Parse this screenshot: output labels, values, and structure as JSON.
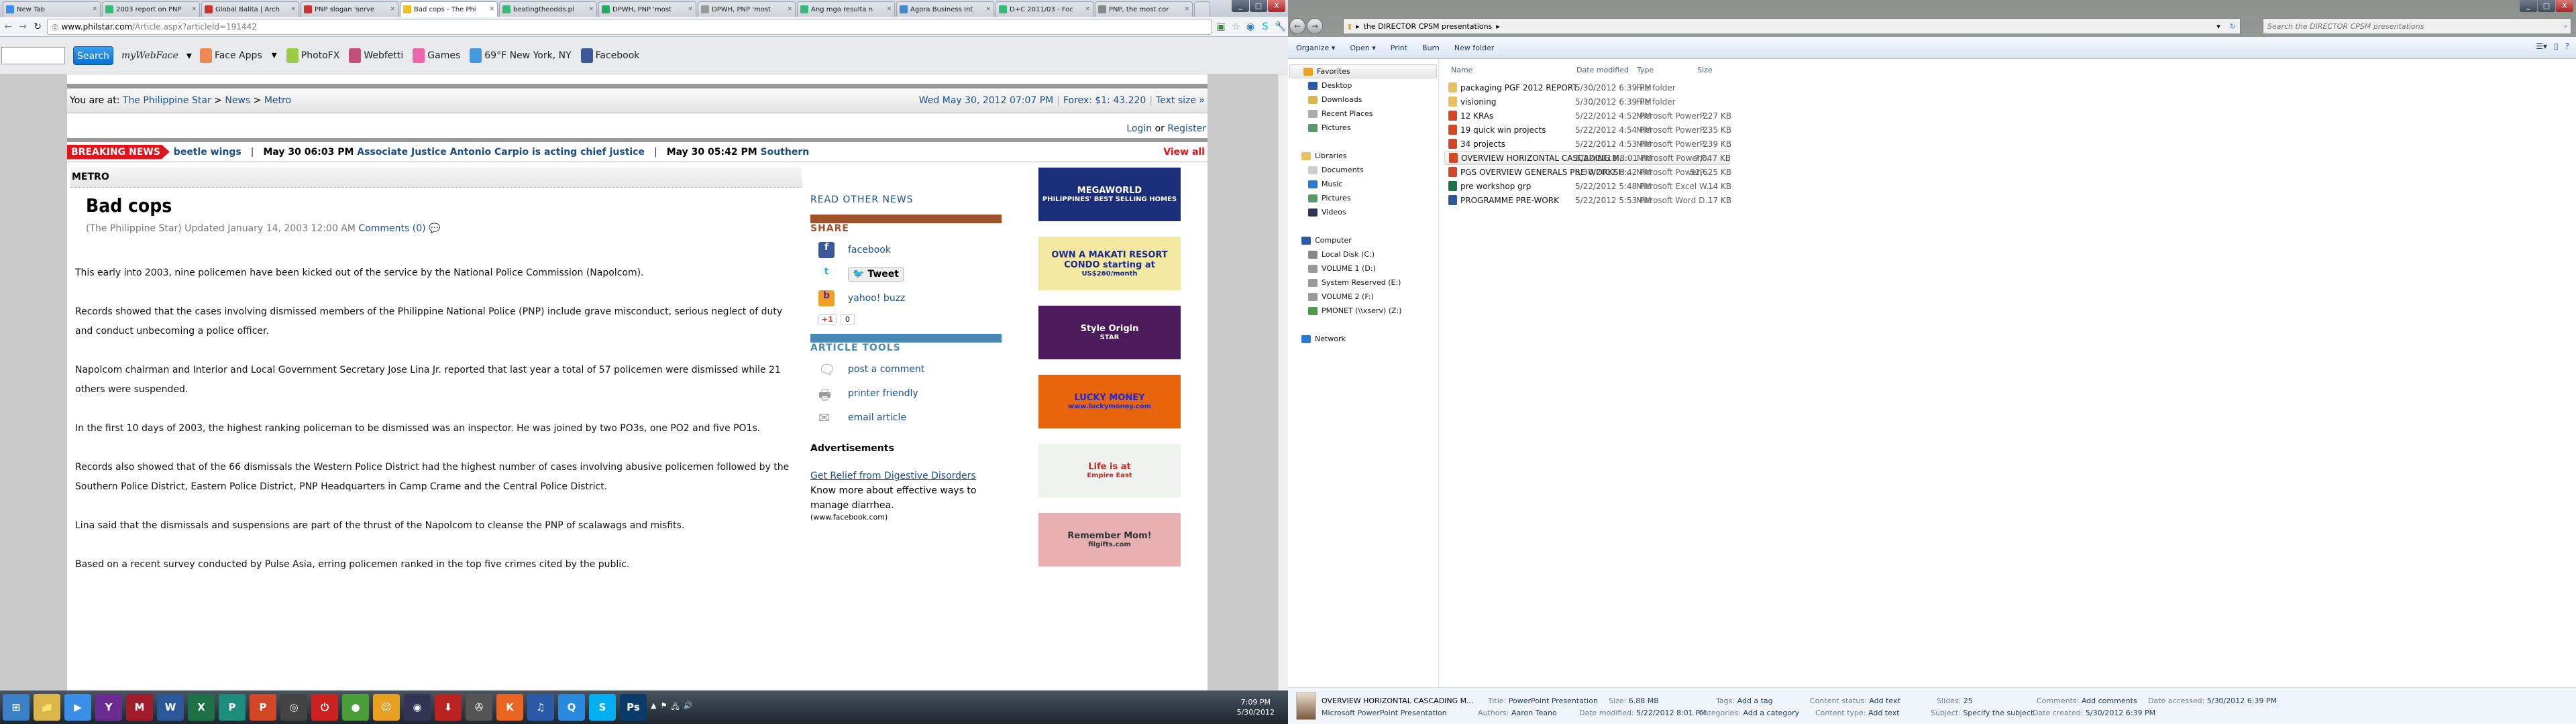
{
  "browser": {
    "tabs": [
      {
        "title": "New Tab",
        "color": "#3a8ee6"
      },
      {
        "title": "2003 report on PNP",
        "color": "#3b7"
      },
      {
        "title": "Global Balita | Arch",
        "color": "#c33"
      },
      {
        "title": "PNP slogan 'serve",
        "color": "#c33"
      },
      {
        "title": "Bad cops - The Phi",
        "color": "#f0c020",
        "active": true
      },
      {
        "title": "beatingtheodds.pl",
        "color": "#3b7"
      },
      {
        "title": "DPWH, PNP 'most",
        "color": "#2a6"
      },
      {
        "title": "DPWH, PNP 'most",
        "color": "#999"
      },
      {
        "title": "Ang mga resulta n",
        "color": "#3b7"
      },
      {
        "title": "Agora Business Int",
        "color": "#48c"
      },
      {
        "title": "D+C 2011/03 - Foc",
        "color": "#3b7"
      },
      {
        "title": "PNP, the most cor",
        "color": "#888"
      }
    ],
    "window_buttons": [
      "_",
      "□",
      "X"
    ],
    "url_host": "www.philstar.com",
    "url_path": "/Article.aspx?articleId=191442",
    "toolbar": {
      "search_placeholder": "",
      "search_label": "Search",
      "mywebface": "myWebFace",
      "items": [
        {
          "label": "Face Apps",
          "color": "#e85"
        },
        {
          "label": "PhotoFX",
          "color": "#9c4"
        },
        {
          "label": "Webfetti",
          "color": "#c2507a"
        },
        {
          "label": "Games",
          "color": "#e6a"
        },
        {
          "label": "69°F New York, NY",
          "color": "#49d"
        },
        {
          "label": "Facebook",
          "color": "#3b5998"
        }
      ]
    }
  },
  "site": {
    "breadcrumb_prefix": "You are at:",
    "breadcrumb": [
      "The Philippine Star",
      "News",
      "Metro"
    ],
    "date": "Wed May 30, 2012 07:07 PM",
    "forex": "Forex: $1: 43.220",
    "text_size": "Text size  »",
    "login": "Login",
    "or": "or",
    "register": "Register",
    "breaking_label": "BREAKING NEWS",
    "ticker": [
      {
        "time": "",
        "head": "beetle wings"
      },
      {
        "time": "May 30 06:03 PM",
        "head": "Associate Justice Antonio Carpio is acting chief justice"
      },
      {
        "time": "May 30 05:42 PM",
        "head": "Southern"
      }
    ],
    "view_all": "View all",
    "section": "METRO",
    "article": {
      "title": "Bad cops",
      "byline": "(The Philippine Star) Updated January 14, 2003 12:00 AM",
      "comments": "Comments (0)",
      "paragraphs": [
        "This early into 2003, nine policemen have been kicked out of the service by the National Police Commission (Napolcom).",
        "Records showed that the cases involving dismissed members of the Philippine National Police (PNP) include grave misconduct, serious neglect of duty and conduct unbecoming a police officer.",
        "Napolcom chairman and Interior and Local Government Secretary Jose Lina Jr. reported that last year a total of 57 policemen were dismissed while 21 others were suspended.",
        "In the first 10 days of 2003, the highest ranking policeman to be dismissed was an inspector. He was joined by two PO3s, one PO2 and five PO1s.",
        "Records also showed that of the 66 dismissals the Western Police District had the highest number of cases involving abusive policemen followed by the Southern Police District, Eastern Police District, PNP Headquarters in Camp Crame and the Central Police District.",
        "Lina said that the dismissals and suspensions are part of the thrust of the Napolcom to cleanse the PNP of scalawags and misfits.",
        "Based on a recent survey conducted by Pulse Asia, erring policemen ranked in the top five crimes cited by the public."
      ]
    },
    "sidebar": {
      "read_other": "READ OTHER NEWS",
      "share": "SHARE",
      "facebook": "facebook",
      "tweet": "Tweet",
      "buzz": "yahoo! buzz",
      "gplus": "+1",
      "gplus_count": "0",
      "tools": "ARTICLE TOOLS",
      "post_comment": "post a comment",
      "printer": "printer friendly",
      "email": "email article",
      "ads_head": "Advertisements",
      "ad_link": "Get Relief from Digestive Disorders",
      "ad_text": "Know more about effective ways to manage diarrhea.",
      "ad_source": "(www.facebook.com)",
      "share_color": "#a0522d",
      "tools_color": "#4a88b5"
    },
    "banners": [
      {
        "line1": "MEGAWORLD",
        "line2": "PHILIPPINES' BEST SELLING HOMES",
        "bg": "#1b2e7a",
        "fg": "#fff"
      },
      {
        "line1": "OWN A MAKATI RESORT CONDO starting at",
        "line2": "US$260/month",
        "bg": "#f3e9a0",
        "fg": "#1a2a8a"
      },
      {
        "line1": "Style Origin",
        "line2": "STAR",
        "bg": "#4a1a5a",
        "fg": "#fff"
      },
      {
        "line1": "LUCKY MONEY",
        "line2": "www.luckymoney.com",
        "bg": "#e8640a",
        "fg": "#1a2adc"
      },
      {
        "line1": "Life is at",
        "line2": "Empire East",
        "bg": "#eef3ee",
        "fg": "#c22"
      },
      {
        "line1": "Remember Mom!",
        "line2": "filgifts.com",
        "bg": "#e8b0b0",
        "fg": "#333"
      }
    ]
  },
  "taskbar": {
    "icons": [
      {
        "g": "⊞",
        "c": "#3a7fc4"
      },
      {
        "g": "📁",
        "c": "#d9b54a"
      },
      {
        "g": "▶",
        "c": "#3a8ee6"
      },
      {
        "g": "Y",
        "c": "#6b2c91"
      },
      {
        "g": "M",
        "c": "#a01c2c"
      },
      {
        "g": "W",
        "c": "#2b5797"
      },
      {
        "g": "X",
        "c": "#1e7145"
      },
      {
        "g": "P",
        "c": "#1e8c7a"
      },
      {
        "g": "P",
        "c": "#d24726"
      },
      {
        "g": "◎",
        "c": "#444"
      },
      {
        "g": "⏻",
        "c": "#c22"
      },
      {
        "g": "●",
        "c": "#4a9e3a"
      },
      {
        "g": "☺",
        "c": "#e8a020"
      },
      {
        "g": "◉",
        "c": "#335"
      },
      {
        "g": "⬇",
        "c": "#b22"
      },
      {
        "g": "✇",
        "c": "#555"
      },
      {
        "g": "K",
        "c": "#e86420"
      },
      {
        "g": "♫",
        "c": "#2a5aa8"
      },
      {
        "g": "Q",
        "c": "#2a8ae0"
      },
      {
        "g": "S",
        "c": "#00aff0"
      },
      {
        "g": "Ps",
        "c": "#0a3a6a"
      }
    ],
    "time": "7:09 PM",
    "date": "5/30/2012"
  },
  "explorer": {
    "window_buttons": [
      "_",
      "□",
      "X"
    ],
    "path": "the DIRECTOR CPSM presentations",
    "search_placeholder": "Search the DIRECTOR CPSM presentations",
    "commands": [
      "Organize ▾",
      "Open ▾",
      "Print",
      "Burn",
      "New folder"
    ],
    "columns": [
      "Name",
      "Date modified",
      "Type",
      "Size"
    ],
    "nav": [
      {
        "label": "Favorites",
        "hd": true,
        "sel": true,
        "c": "#f0a020"
      },
      {
        "label": "Desktop",
        "c": "#2a5aa8"
      },
      {
        "label": "Downloads",
        "c": "#d9b54a"
      },
      {
        "label": "Recent Places",
        "c": "#aaa"
      },
      {
        "label": "Pictures",
        "c": "#5a9a6a"
      },
      {
        "gap": true
      },
      {
        "label": "Libraries",
        "hd": true,
        "c": "#e8c060"
      },
      {
        "label": "Documents",
        "c": "#ccc"
      },
      {
        "label": "Music",
        "c": "#2a7ad0"
      },
      {
        "label": "Pictures",
        "c": "#5a9a6a"
      },
      {
        "label": "Videos",
        "c": "#335"
      },
      {
        "gap": true
      },
      {
        "label": "Computer",
        "hd": true,
        "c": "#2a5aa8"
      },
      {
        "label": "Local Disk (C:)",
        "c": "#888"
      },
      {
        "label": "VOLUME 1 (D:)",
        "c": "#999"
      },
      {
        "label": "System Reserved (E:)",
        "c": "#999"
      },
      {
        "label": "VOLUME 2 (F:)",
        "c": "#999"
      },
      {
        "label": "PMONET (\\\\xserv) (Z:)",
        "c": "#4a9a4a"
      },
      {
        "gap": true
      },
      {
        "label": "Network",
        "hd": true,
        "c": "#2a7ad0"
      }
    ],
    "files": [
      {
        "name": "packaging PGF 2012 REPORT",
        "date": "5/30/2012 6:39 PM",
        "type": "File folder",
        "size": "",
        "kind": "folder"
      },
      {
        "name": "visioning",
        "date": "5/30/2012 6:39 PM",
        "type": "File folder",
        "size": "",
        "kind": "folder"
      },
      {
        "name": "12 KRAs",
        "date": "5/22/2012 4:52 PM",
        "type": "Microsoft PowerP...",
        "size": "227 KB",
        "kind": "ppt"
      },
      {
        "name": "19 quick win projects",
        "date": "5/22/2012 4:54 PM",
        "type": "Microsoft PowerP...",
        "size": "235 KB",
        "kind": "ppt"
      },
      {
        "name": "34 projects",
        "date": "5/22/2012 4:53 PM",
        "type": "Microsoft PowerP...",
        "size": "239 KB",
        "kind": "ppt"
      },
      {
        "name": "OVERVIEW HORIZONTAL CASCADING M...",
        "date": "5/22/2012 8:01 PM",
        "type": "Microsoft PowerP...",
        "size": "7,047 KB",
        "kind": "ppt",
        "selected": true
      },
      {
        "name": "PGS OVERVIEW GENERALS PRE WORKSH...",
        "date": "5/30/2012 6:42 PM",
        "type": "Microsoft PowerP...",
        "size": "52,625 KB",
        "kind": "ppt"
      },
      {
        "name": "pre workshop grp",
        "date": "5/22/2012 5:48 PM",
        "type": "Microsoft Excel W...",
        "size": "14 KB",
        "kind": "xls"
      },
      {
        "name": "PROGRAMME PRE-WORK",
        "date": "5/22/2012 5:53 PM",
        "type": "Microsoft Word D...",
        "size": "17 KB",
        "kind": "doc"
      }
    ],
    "details": {
      "name": "OVERVIEW HORIZONTAL CASCADING M...",
      "filetype": "Microsoft PowerPoint Presentation",
      "props": [
        {
          "k": "Title:",
          "v": "PowerPoint Presentation"
        },
        {
          "k": "Authors:",
          "v": "Aaron Teano"
        },
        {
          "k": "Size:",
          "v": "6.88 MB"
        },
        {
          "k": "Date modified:",
          "v": "5/22/2012 8:01 PM"
        },
        {
          "k": "Tags:",
          "v": "Add a tag"
        },
        {
          "k": "Categories:",
          "v": "Add a category"
        },
        {
          "k": "Content status:",
          "v": "Add text"
        },
        {
          "k": "Content type:",
          "v": "Add text"
        },
        {
          "k": "Slides:",
          "v": "25"
        },
        {
          "k": "Subject:",
          "v": "Specify the subject"
        },
        {
          "k": "Comments:",
          "v": "Add comments"
        },
        {
          "k": "Date created:",
          "v": "5/30/2012 6:39 PM"
        },
        {
          "k": "Date accessed:",
          "v": "5/30/2012 6:39 PM"
        }
      ]
    }
  }
}
